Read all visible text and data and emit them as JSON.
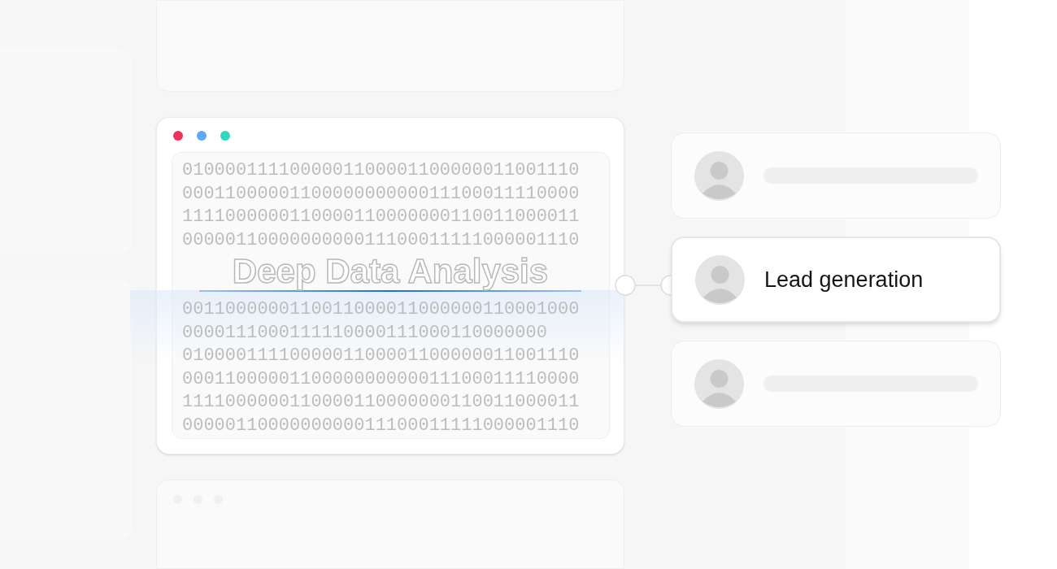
{
  "main_window": {
    "dots": [
      {
        "color": "#f0325a"
      },
      {
        "color": "#5aaaf0"
      },
      {
        "color": "#2ed9c0"
      }
    ],
    "binary_lines": [
      "0100001111000001100001100000011001110",
      "0001100000110000000000011100011110000",
      "1111000000110000110000000110011000011",
      "0000011000000000011100011111000001110",
      "0011000000110011000011000000110001000",
      "0000111000111110000111000110000000",
      "0100001111000001100001100000011001110",
      "0001100000110000000000011100011110000",
      "1111000000110000110000000110011000011",
      "0000011000000000011100011111000001110"
    ],
    "title": "Deep Data Analysis"
  },
  "contacts": [
    {
      "kind": "placeholder",
      "selected": false
    },
    {
      "kind": "label",
      "label": "Lead generation",
      "selected": true
    },
    {
      "kind": "placeholder",
      "selected": false
    }
  ]
}
